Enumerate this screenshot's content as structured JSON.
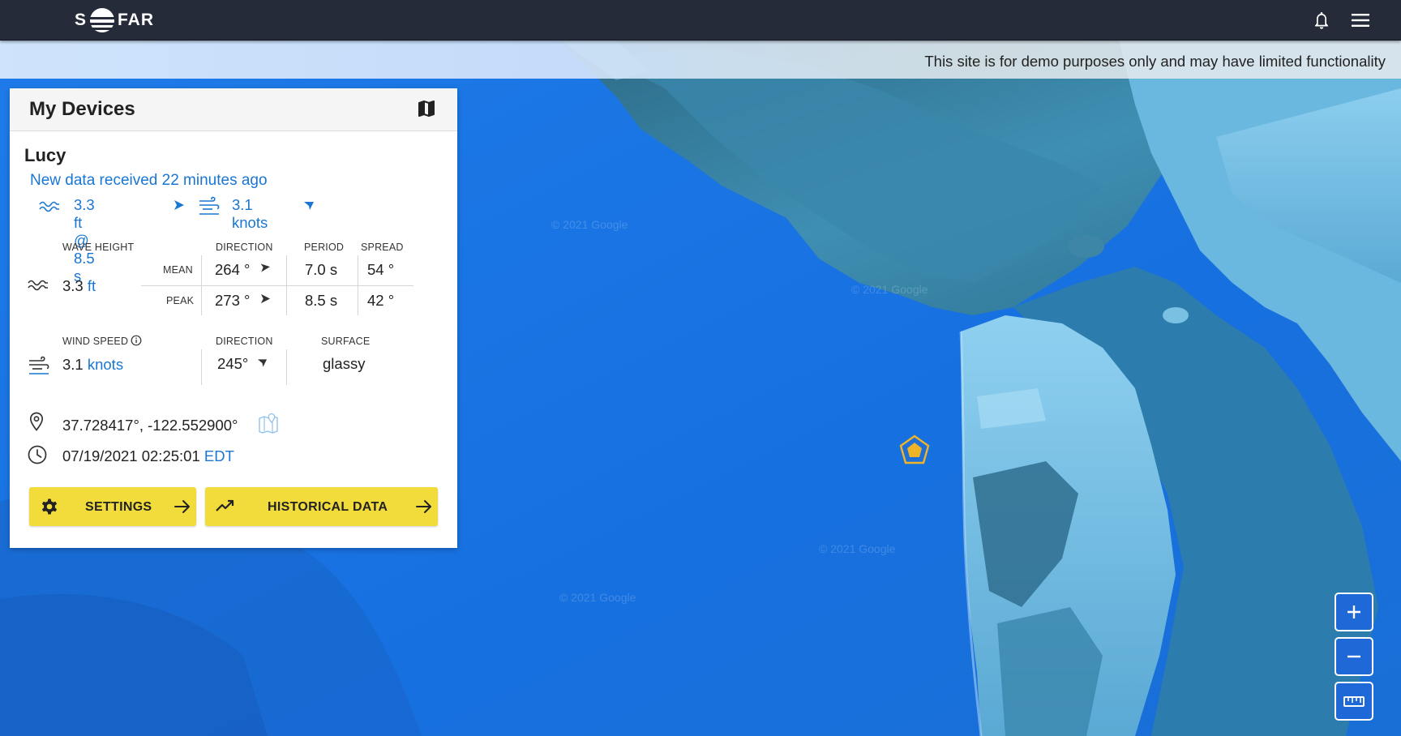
{
  "header": {
    "logo_text_left": "S",
    "logo_text_right": "FAR",
    "icons": [
      "bell-icon",
      "hamburger-menu-icon"
    ]
  },
  "banner": {
    "text": "This site is for demo purposes only and may have limited functionality"
  },
  "panel": {
    "title": "My Devices",
    "device": {
      "name": "Lucy",
      "status": "New data received 22 minutes ago",
      "summary_wave": "3.3 ft @ 8.5 s",
      "summary_wind": "3.1 knots"
    },
    "waves": {
      "height_label": "WAVE HEIGHT",
      "height_value": "3.3",
      "height_unit": "ft",
      "direction_label": "DIRECTION",
      "period_label": "PERIOD",
      "spread_label": "SPREAD",
      "mean_label": "MEAN",
      "peak_label": "PEAK",
      "mean_direction": "264 °",
      "mean_period": "7.0 s",
      "mean_spread": "54 °",
      "peak_direction": "273 °",
      "peak_period": "8.5 s",
      "peak_spread": "42 °"
    },
    "wind": {
      "speed_label": "WIND SPEED",
      "speed_value": "3.1",
      "speed_unit": "knots",
      "direction_label": "DIRECTION",
      "direction_value": "245°",
      "surface_label": "SURFACE",
      "surface_value": "glassy"
    },
    "location": {
      "coords": "37.728417°, -122.552900°"
    },
    "time": {
      "datetime": "07/19/2021 02:25:01",
      "tz": "EDT"
    },
    "buttons": {
      "settings": "SETTINGS",
      "historical": "HISTORICAL DATA"
    }
  },
  "map": {
    "watermark": "© 2021 Google",
    "zoom_in": "+",
    "zoom_out": "−",
    "colors": {
      "ocean": "#1b74e4",
      "land": "#4b9cc0",
      "accent": "#f2dc3c",
      "marker": "#f0b429"
    }
  }
}
